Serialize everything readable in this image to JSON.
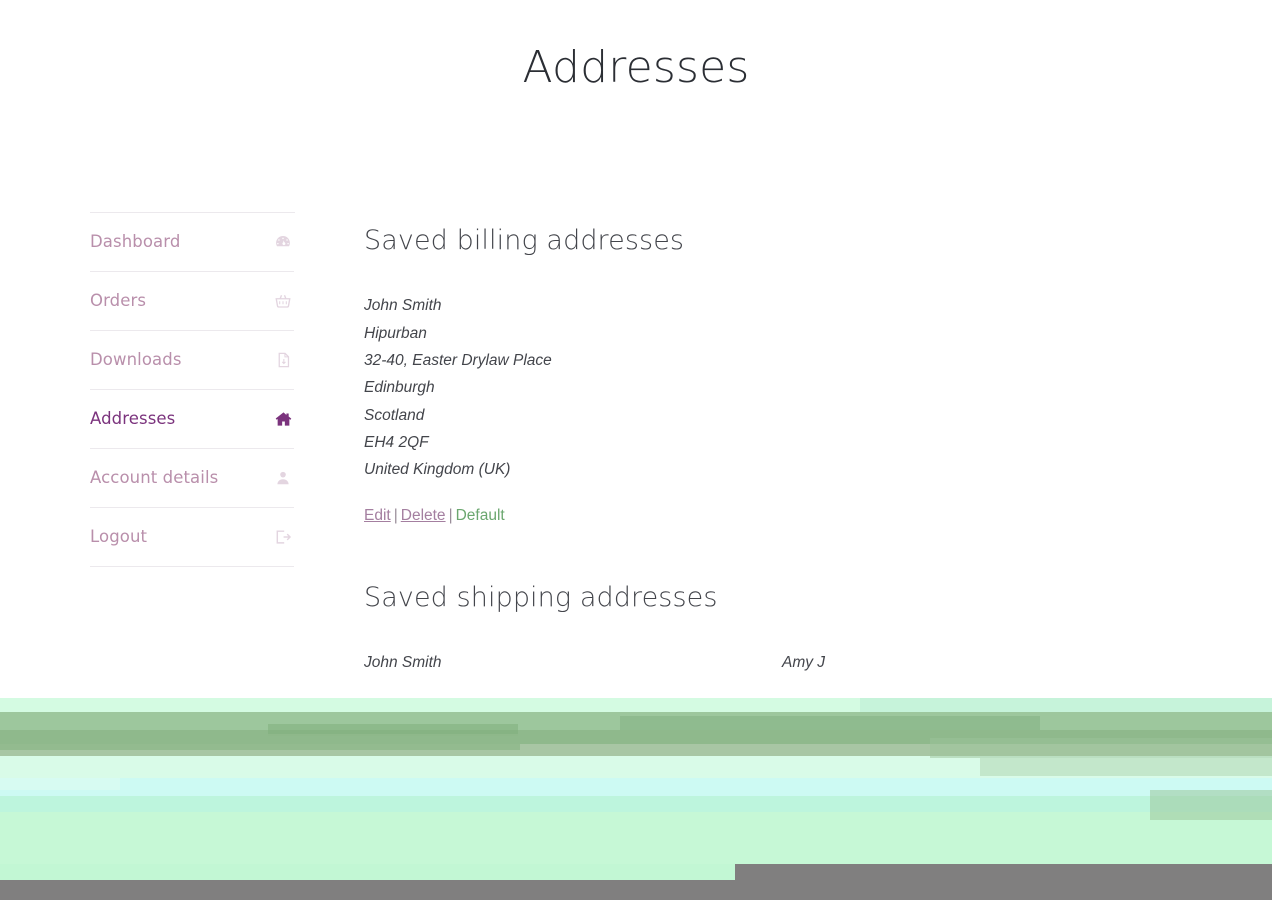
{
  "page": {
    "title": "Addresses"
  },
  "sidebar": {
    "items": [
      {
        "label": "Dashboard",
        "icon": "dashboard-icon",
        "active": false
      },
      {
        "label": "Orders",
        "icon": "basket-icon",
        "active": false
      },
      {
        "label": "Downloads",
        "icon": "download-file-icon",
        "active": false
      },
      {
        "label": "Addresses",
        "icon": "home-icon",
        "active": true
      },
      {
        "label": "Account details",
        "icon": "user-icon",
        "active": false
      },
      {
        "label": "Logout",
        "icon": "logout-icon",
        "active": false
      }
    ]
  },
  "main": {
    "billing": {
      "heading": "Saved billing addresses",
      "address_lines": [
        "John Smith",
        "Hipurban",
        "32-40, Easter Drylaw Place",
        "Edinburgh",
        "Scotland",
        "EH4 2QF",
        "United Kingdom (UK)"
      ],
      "actions": {
        "edit": "Edit",
        "delete": "Delete",
        "default": "Default",
        "separator": "|"
      }
    },
    "shipping": {
      "heading": "Saved shipping addresses",
      "addresses": [
        {
          "name": "John Smith"
        },
        {
          "name": "Amy J"
        }
      ]
    }
  },
  "colors": {
    "nav_link": "#b98fab",
    "nav_link_active": "#7b337d",
    "link": "#a47fa0",
    "default_link": "#6ba76f",
    "text": "#43454b",
    "divider": "#ece9ed",
    "glitch_green": "#c2f7d4",
    "glitch_cyan": "#ccfdf5",
    "glitch_grey": "#807f7f"
  }
}
